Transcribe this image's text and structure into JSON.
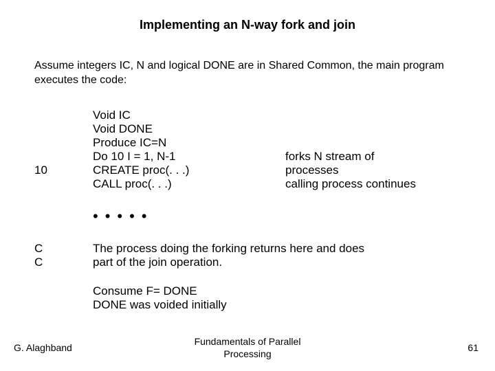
{
  "title": "Implementing an N-way fork and join",
  "intro": "Assume integers IC, N and logical DONE are in Shared Common, the main program executes the code:",
  "code": {
    "label10": "10",
    "lines": {
      "l1": "Void IC",
      "l2": "Void DONE",
      "l3": "Produce IC=N",
      "l4": "Do 10 I = 1, N-1",
      "l5": "CREATE proc(. . .)",
      "l6": "CALL proc(. . .)"
    },
    "notes": {
      "n4": "forks N stream of",
      "n5": "processes",
      "n6": "calling process continues"
    }
  },
  "dots": "•••••",
  "comment": {
    "labelC1": "C",
    "labelC2": "C",
    "line1": "The process doing the forking returns here and does",
    "line2": " part of the join operation."
  },
  "bottom": {
    "b1": "Consume F= DONE",
    "b2": "DONE was voided initially"
  },
  "footer": {
    "left": "G. Alaghband",
    "center1": "Fundamentals of Parallel",
    "center2": "Processing",
    "right": "61"
  }
}
